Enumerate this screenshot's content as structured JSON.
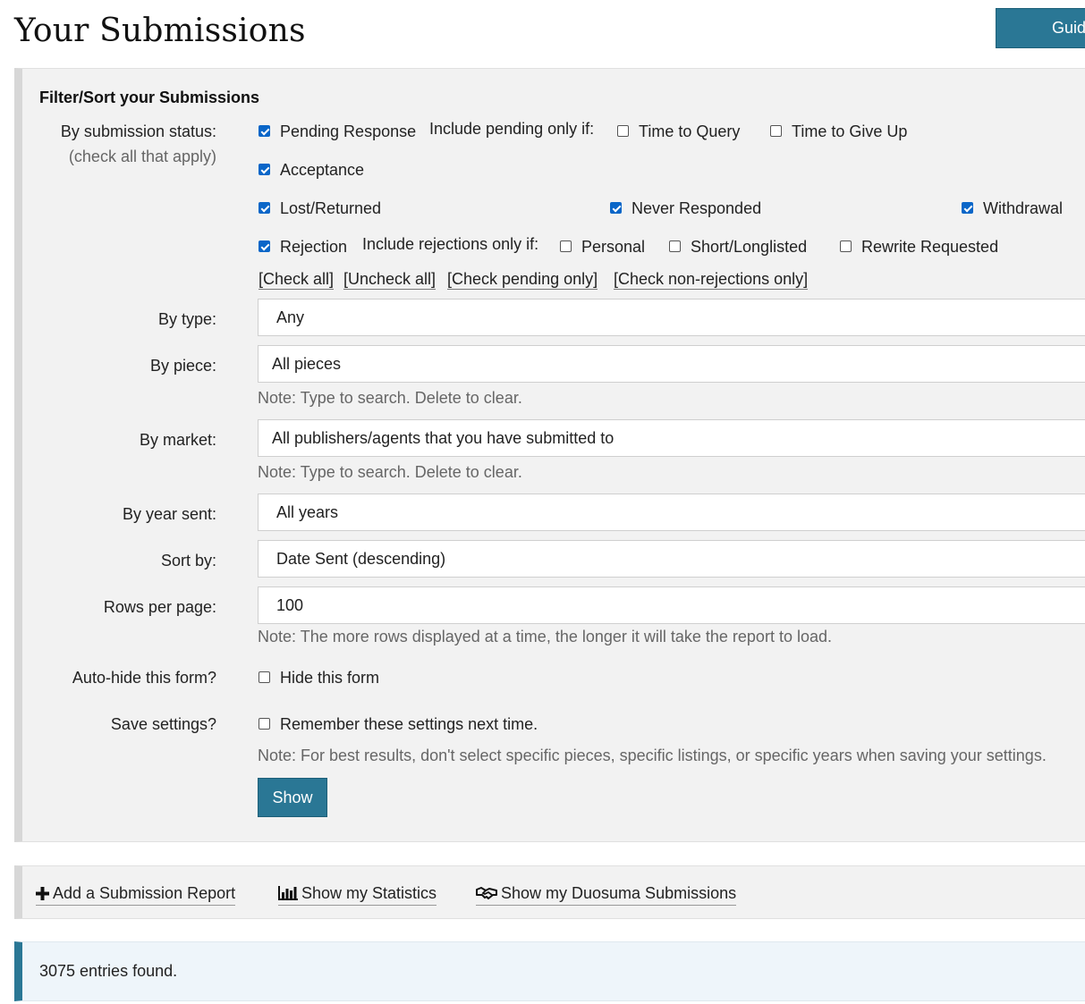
{
  "page": {
    "title": "Your Submissions",
    "guide_button": "Guid"
  },
  "filter": {
    "heading": "Filter/Sort your Submissions",
    "status": {
      "label": "By submission status:",
      "sublabel": "(check all that apply)",
      "pending": {
        "label": "Pending Response",
        "checked": true
      },
      "pending_only_if": "Include pending only if:",
      "time_to_query": {
        "label": "Time to Query",
        "checked": false
      },
      "time_to_give_up": {
        "label": "Time to Give Up",
        "checked": false
      },
      "acceptance": {
        "label": "Acceptance",
        "checked": true
      },
      "lost_returned": {
        "label": "Lost/Returned",
        "checked": true
      },
      "never_responded": {
        "label": "Never Responded",
        "checked": true
      },
      "withdrawal": {
        "label": "Withdrawal",
        "checked": true
      },
      "rejection": {
        "label": "Rejection",
        "checked": true
      },
      "rejections_only_if": "Include rejections only if:",
      "personal": {
        "label": "Personal",
        "checked": false
      },
      "short_longlisted": {
        "label": "Short/Longlisted",
        "checked": false
      },
      "rewrite_requested": {
        "label": "Rewrite Requested",
        "checked": false
      },
      "links": [
        "[Check all]",
        "[Uncheck all]",
        "[Check pending only]",
        "[Check non-rejections only]"
      ]
    },
    "type": {
      "label": "By type:",
      "value": "Any"
    },
    "piece": {
      "label": "By piece:",
      "value": "All pieces",
      "note": "Note: Type to search. Delete to clear."
    },
    "market": {
      "label": "By market:",
      "value": "All publishers/agents that you have submitted to",
      "note": "Note: Type to search. Delete to clear."
    },
    "year": {
      "label": "By year sent:",
      "value": "All years"
    },
    "sort": {
      "label": "Sort by:",
      "value": "Date Sent (descending)"
    },
    "rows": {
      "label": "Rows per page:",
      "value": "100",
      "note": "Note: The more rows displayed at a time, the longer it will take the report to load."
    },
    "autohide": {
      "label": "Auto-hide this form?",
      "option": "Hide this form",
      "checked": false
    },
    "save": {
      "label": "Save settings?",
      "option": "Remember these settings next time.",
      "checked": false,
      "note": "Note: For best results, don't select specific pieces, specific listings, or specific years when saving your settings."
    },
    "show_button": "Show"
  },
  "actions": {
    "add_report": {
      "label": "Add a Submission Report",
      "icon": "plus-icon"
    },
    "statistics": {
      "label": "Show my Statistics",
      "icon": "bar-chart-icon"
    },
    "duosuma": {
      "label": "Show my Duosuma Submissions",
      "icon": "handshake-icon"
    }
  },
  "results": {
    "text": "3075 entries found."
  }
}
